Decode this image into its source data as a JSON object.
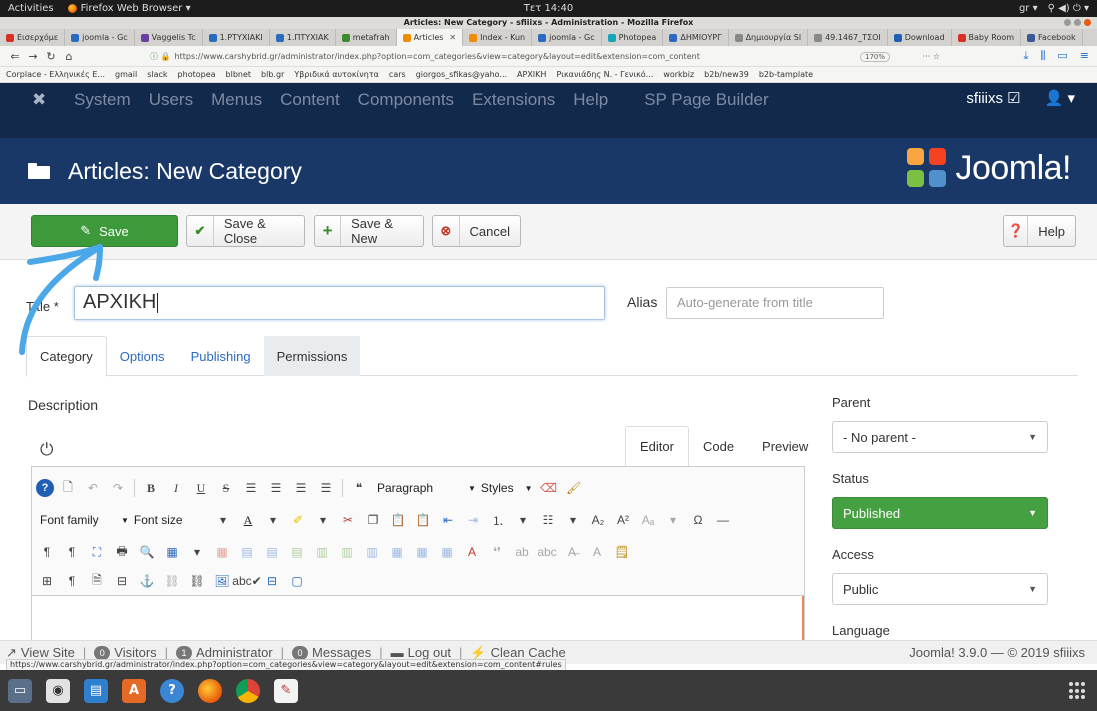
{
  "system_bar": {
    "activities": "Activities",
    "app": "Firefox Web Browser ▾",
    "clock": "Τετ 14:40",
    "lang": "gr ▾",
    "tray": "⚲ ◀) ⏻ ▾"
  },
  "window": {
    "title": "Articles: New Category - sfiiixs - Administration - Mozilla Firefox"
  },
  "tabs": [
    {
      "label": "Εισερχόμε",
      "color": "#d93025"
    },
    {
      "label": "joomla - Gc",
      "color": "#2a6ac1"
    },
    {
      "label": "Vaggelis Tc",
      "color": "#6b3fa0"
    },
    {
      "label": "1.PTYXIAKI",
      "color": "#2a6ac1"
    },
    {
      "label": "1.ΠΤΥΧΙΑΚ",
      "color": "#2a6ac1"
    },
    {
      "label": "metafrah",
      "color": "#3a8b2e"
    },
    {
      "label": "Articles",
      "color": "#f08c00",
      "active": true
    },
    {
      "label": "Index - Kun",
      "color": "#f08c00"
    },
    {
      "label": "joomla - Gc",
      "color": "#2a6ac1"
    },
    {
      "label": "Photopea",
      "color": "#18a4b8"
    },
    {
      "label": "ΔΗΜΙΟΥΡΓ",
      "color": "#2a6ac1"
    },
    {
      "label": "Δημιουργία Sl",
      "color": "#888888"
    },
    {
      "label": "49.1467_ΤΣΟΙ",
      "color": "#888888"
    },
    {
      "label": "Download",
      "color": "#1f5fb4"
    },
    {
      "label": "Baby Room",
      "color": "#d93025"
    },
    {
      "label": "Facebook",
      "color": "#3b5998"
    }
  ],
  "nav": {
    "url": "https://www.carshybrid.gr/administrator/index.php?option=com_categories&view=category&layout=edit&extension=com_content",
    "zoom": "170%"
  },
  "bookmarks": [
    "Corplace - Ελληνικές Ε...",
    "gmail",
    "slack",
    "photopea",
    "blbnet",
    "blb.gr",
    "Υβριδικά αυτοκίνητα",
    "cars",
    "giorgos_sfikas@yaho...",
    "ΑΡΧΙΚΗ",
    "Ρικανιάδης Ν. - Γενικό...",
    "workbiz",
    "b2b/new39",
    "b2b-tamplate"
  ],
  "joomla_nav": {
    "menu": [
      "System",
      "Users",
      "Menus",
      "Content",
      "Components",
      "Extensions",
      "Help",
      "SP Page Builder"
    ],
    "user": "sfiiixs ☑",
    "user_icon": "👤 ▾"
  },
  "header": {
    "title": "Articles: New Category",
    "brand": "Joomla!"
  },
  "toolbar": {
    "save": "Save",
    "save_close": "Save & Close",
    "save_new": "Save & New",
    "cancel": "Cancel",
    "help": "Help"
  },
  "form": {
    "title_label": "Title *",
    "title_value": "ΑΡΧΙΚΗ",
    "alias_label": "Alias",
    "alias_placeholder": "Auto-generate from title",
    "tabs": [
      "Category",
      "Options",
      "Publishing",
      "Permissions"
    ],
    "description_label": "Description"
  },
  "editor": {
    "tabs": [
      "Editor",
      "Code",
      "Preview"
    ],
    "paragraph": "Paragraph",
    "styles": "Styles",
    "font_family": "Font family",
    "font_size": "Font size"
  },
  "sidebar": {
    "parent_label": "Parent",
    "parent_value": "- No parent -",
    "status_label": "Status",
    "status_value": "Published",
    "access_label": "Access",
    "access_value": "Public",
    "language_label": "Language"
  },
  "status_bar": {
    "view_site": "View Site",
    "visitors_count": "0",
    "visitors": "Visitors",
    "admin_count": "1",
    "administrator": "Administrator",
    "messages_count": "0",
    "messages": "Messages",
    "logout": "Log out",
    "clean_cache": "Clean Cache",
    "version": "Joomla! 3.9.0 — © 2019 sfiiixs",
    "link_tip": "https://www.carshybrid.gr/administrator/index.php?option=com_categories&view=category&layout=edit&extension=com_content#rules"
  },
  "colors": {
    "joomla_navy": "#13294b",
    "header_blue": "#1a3867",
    "save_green": "#3c9a3a",
    "status_green": "#45a041",
    "annotation_arrow": "#4aa8e8"
  }
}
